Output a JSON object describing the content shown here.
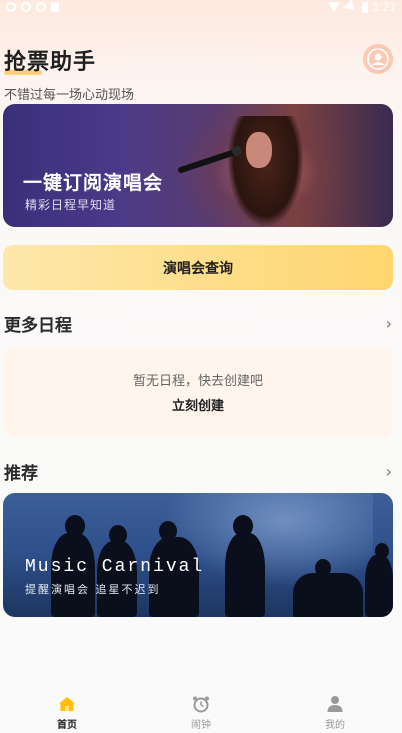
{
  "status_bar": {
    "time": "1:27"
  },
  "header": {
    "title": "抢票助手",
    "subtitle": "不错过每一场心动现场"
  },
  "banner": {
    "title": "一键订阅演唱会",
    "subtitle": "精彩日程早知道"
  },
  "query_button": {
    "label": "演唱会查询"
  },
  "schedule": {
    "title": "更多日程",
    "empty_text": "暂无日程，快去创建吧",
    "create_label": "立刻创建"
  },
  "recommend": {
    "title": "推荐",
    "banner_title": "Music Carnival",
    "banner_subtitle": "提醒演唱会 追星不迟到"
  },
  "tabs": [
    {
      "label": "首页",
      "icon": "home-icon",
      "active": true
    },
    {
      "label": "闹钟",
      "icon": "alarm-clock-icon",
      "active": false
    },
    {
      "label": "我的",
      "icon": "person-icon",
      "active": false
    }
  ],
  "colors": {
    "accent": "#ffd56f",
    "accent_light": "#fde8ab",
    "avatar": "#fbc9b4",
    "active_tab_icon": "#ffc107",
    "inactive_tab_icon": "#9a9a9a"
  }
}
